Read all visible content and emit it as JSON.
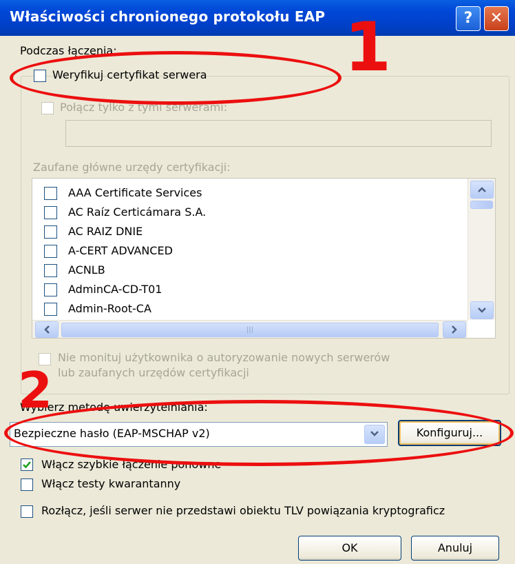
{
  "window": {
    "title": "Właściwości chronionego protokołu EAP",
    "help_label": "?",
    "close_label": "✕"
  },
  "connection": {
    "section_label": "Podczas łączenia:",
    "verify_cert_label": "Weryfikuj certyfikat serwera",
    "verify_cert_checked": false,
    "connect_only_label": "Połącz tylko z tymi serwerami:",
    "servers_value": "",
    "trusted_roots_label": "Zaufane główne urzędy certyfikacji:",
    "certificates": [
      {
        "label": "AAA Certificate Services",
        "checked": false
      },
      {
        "label": "AC Raíz Certicámara S.A.",
        "checked": false
      },
      {
        "label": "AC RAIZ DNIE",
        "checked": false
      },
      {
        "label": "A-CERT ADVANCED",
        "checked": false
      },
      {
        "label": "ACNLB",
        "checked": false
      },
      {
        "label": "AdminCA-CD-T01",
        "checked": false
      },
      {
        "label": "Admin-Root-CA",
        "checked": false
      }
    ],
    "no_prompt_label_line1": "Nie monituj użytkownika o autoryzowanie nowych serwerów",
    "no_prompt_label_line2": "lub zaufanych urzędów certyfikacji"
  },
  "auth": {
    "method_label": "Wybierz metodę uwierzytelniania:",
    "selected_method": "Bezpieczne hasło (EAP-MSCHAP v2)",
    "configure_label": "Konfiguruj...",
    "fast_reconnect_label": "Włącz szybkie łączenie ponowne",
    "fast_reconnect_checked": true,
    "quarantine_label": "Włącz testy kwarantanny",
    "quarantine_checked": false,
    "disconnect_label": "Rozłącz, jeśli serwer nie przedstawi obiektu TLV powiązania kryptograficz",
    "disconnect_checked": false
  },
  "buttons": {
    "ok_label": "OK",
    "cancel_label": "Anuluj"
  },
  "annotations": {
    "marker_1": "1",
    "marker_2": "2",
    "color": "#ec0f0f"
  },
  "icons": {
    "scroll_up": "chevron-up-icon",
    "scroll_down": "chevron-down-icon",
    "scroll_left": "chevron-left-icon",
    "scroll_right": "chevron-right-icon",
    "combo_arrow": "chevron-down-icon",
    "checkmark": "checkmark-icon"
  }
}
